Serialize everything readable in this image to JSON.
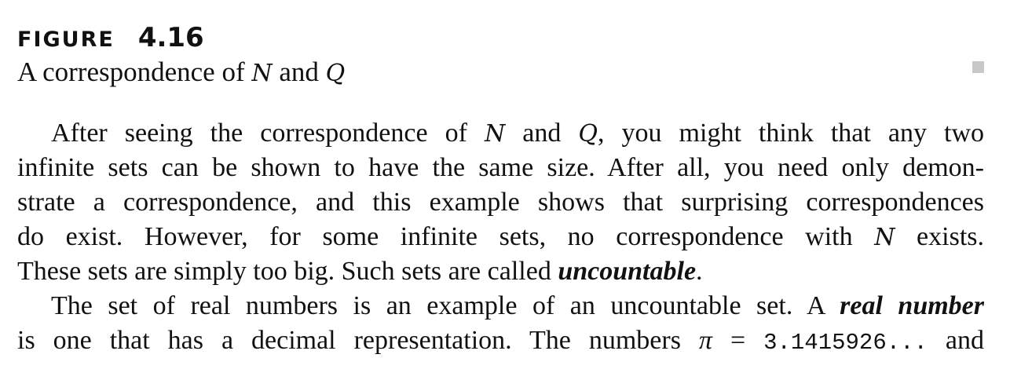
{
  "figure": {
    "label": "FIGURE",
    "number": "4.16",
    "caption_pre": "A correspondence of ",
    "caption_N": "N",
    "caption_mid": " and ",
    "caption_Q": "Q"
  },
  "para1": {
    "l1_a": "After seeing the correspondence of ",
    "l1_N": "N",
    "l1_b": " and ",
    "l1_Q": "Q",
    "l1_c": ", you might think that any two",
    "l2": "infinite sets can be shown to have the same size. After all, you need only demon-",
    "l3": "strate a correspondence, and this example shows that surprising correspondences",
    "l4_a": "do exist.  However, for some infinite sets, no correspondence with ",
    "l4_N": "N",
    "l4_b": " exists.",
    "l5_a": "These sets are simply too big. Such sets are called ",
    "l5_term": "uncountable",
    "l5_b": "."
  },
  "para2": {
    "l1_a": "The set of real numbers is an example of an uncountable set. A ",
    "l1_term": "real number",
    "l2_a": "is one that has a decimal representation. The numbers ",
    "l2_pi": "π",
    "l2_eq": " = ",
    "l2_value": "3.1415926...",
    "l2_b": " and"
  }
}
